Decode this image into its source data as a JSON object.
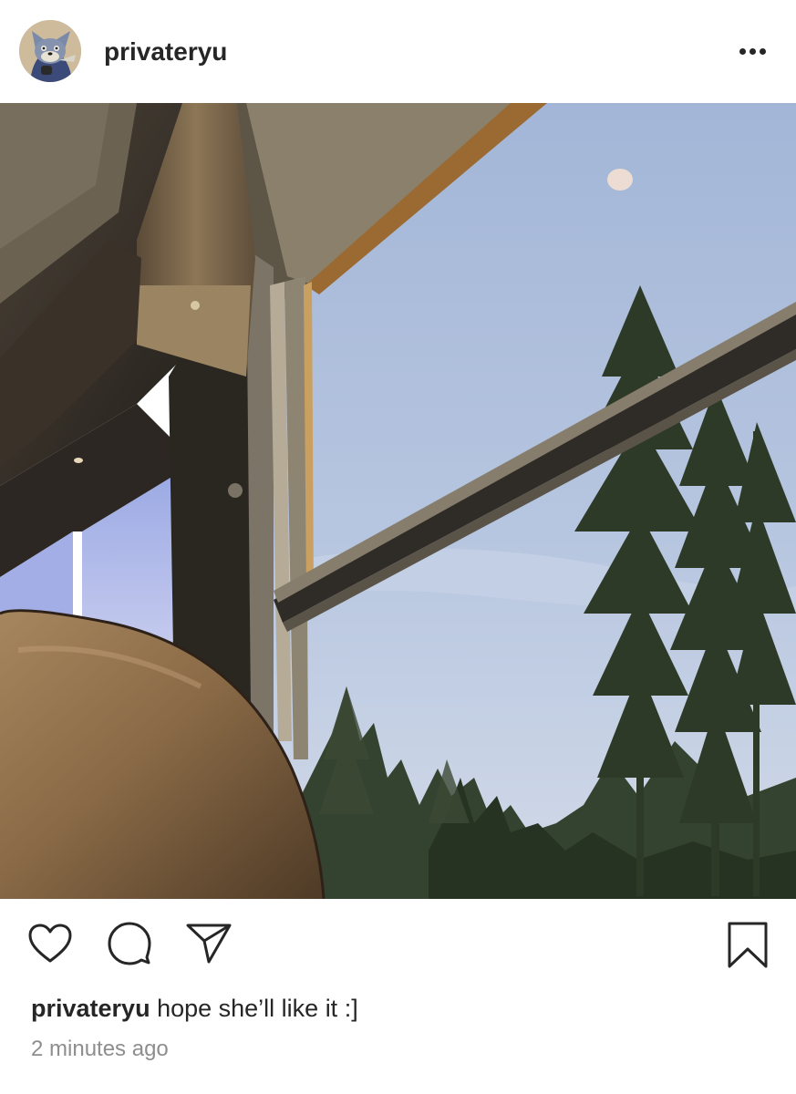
{
  "post": {
    "username": "privateryu",
    "caption_user": "privateryu",
    "caption_text": "hope she’ll like it :]",
    "timestamp": "2 minutes ago"
  },
  "icons": {
    "more": "more-horizontal-icon",
    "like": "heart-icon",
    "comment": "comment-bubble-icon",
    "share": "paper-plane-icon",
    "save": "bookmark-icon"
  },
  "colors": {
    "text": "#262626",
    "secondary_text": "#8e8e8e",
    "background": "#ffffff"
  }
}
